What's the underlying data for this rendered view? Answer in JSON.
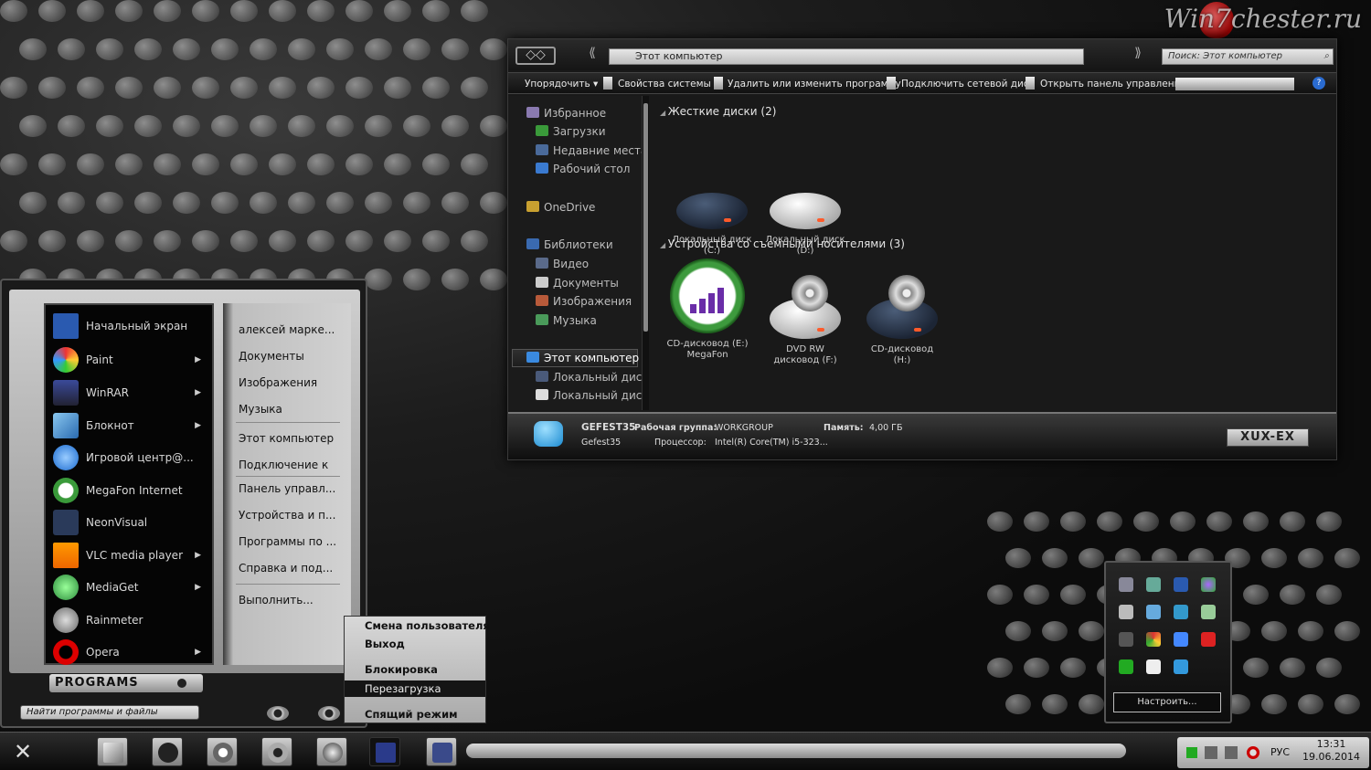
{
  "watermark": "Win7chester.ru",
  "explorer": {
    "address": "Этот компьютер",
    "search_placeholder": "Поиск: Этот компьютер",
    "commands": [
      "Упорядочить ▾",
      "Свойства системы",
      "Удалить или изменить программу",
      "Подключить сетевой диск",
      "Открыть панель управления"
    ],
    "nav": {
      "favorites": "Избранное",
      "downloads": "Загрузки",
      "recent": "Недавние места",
      "desktop": "Рабочий стол",
      "onedrive": "OneDrive",
      "libraries": "Библиотеки",
      "video": "Видео",
      "documents": "Документы",
      "images": "Изображения",
      "music": "Музыка",
      "this_pc": "Этот компьютер",
      "local1": "Локальный диск",
      "local2": "Локальный диск"
    },
    "groups": {
      "hdd": "Жесткие диски (2)",
      "removable": "Устройства со съемными носителями (3)"
    },
    "drives": {
      "c_line1": "Локальный диск",
      "c_line2": "(C:)",
      "d_line1": "Локальный диск",
      "d_line2": "(D:)",
      "e_line1": "CD-дисковод (E:)",
      "e_line2": "MegaFon",
      "f_line1": "DVD RW",
      "f_line2": "дисковод (F:)",
      "h_line1": "CD-дисковод (H:)"
    },
    "details": {
      "computer": "GEFEST35",
      "workgroup_label": "Рабочая группа:",
      "workgroup": "WORKGROUP",
      "memory_label": "Память:",
      "memory": "4,00 ГБ",
      "user": "Gefest35",
      "cpu_label": "Процессор:",
      "cpu": "Intel(R) Core(TM) i5-323...",
      "logo": "XUX-EX"
    }
  },
  "startmenu": {
    "programs": [
      "Начальный экран",
      "Paint",
      "WinRAR",
      "Блокнот",
      "Игровой центр@...",
      "MegaFon Internet",
      "NeonVisual",
      "VLC media player",
      "MediaGet",
      "Rainmeter",
      "Opera"
    ],
    "right": [
      "алексей марке...",
      "Документы",
      "Изображения",
      "Музыка",
      "Этот компьютер",
      "Подключение к",
      "Панель управл...",
      "Устройства и п...",
      "Программы по ...",
      "Справка и под...",
      "Выполнить..."
    ],
    "programs_button": "PROGRAMS",
    "search_placeholder": "Найти программы и файлы"
  },
  "powermenu": [
    "Смена пользователя",
    "Выход",
    "Блокировка",
    "Перезагрузка",
    "Спящий режим"
  ],
  "tray": {
    "customize": "Настроить..."
  },
  "taskbar": {
    "lang": "РУС",
    "time": "13:31",
    "date": "19.06.2014"
  }
}
